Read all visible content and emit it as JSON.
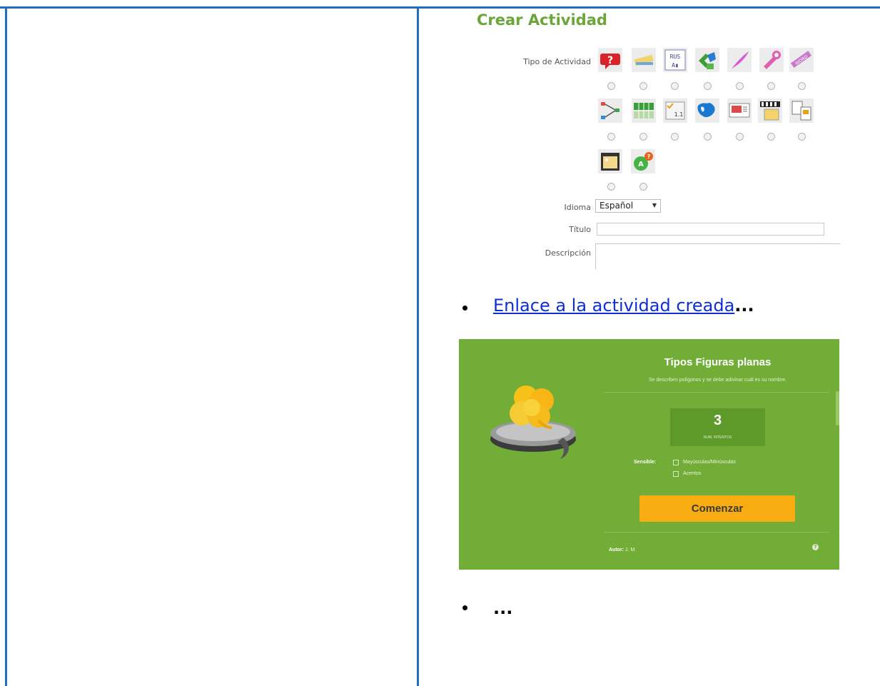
{
  "form": {
    "heading": "Crear Actividad",
    "tipo_label": "Tipo de Actividad",
    "idioma_label": "Idioma",
    "idioma_value": "Español",
    "titulo_label": "Título",
    "descripcion_label": "Descripción",
    "activity_icons": [
      "question-bubble-icon",
      "pencil-ruler-icon",
      "letter-grid-icon",
      "puzzle-icon",
      "feather-pen-icon",
      "wrench-icon",
      "crossword-icon",
      "concept-map-icon",
      "green-grid-icon",
      "numbered-list-icon",
      "world-map-icon",
      "slideshow-icon",
      "film-strip-icon",
      "card-pairs-icon",
      "photo-frame-icon",
      "green-question-icon"
    ]
  },
  "bullets": {
    "link_text": "Enlace a la actividad creada",
    "link_suffix": "...",
    "second_bullet": "..."
  },
  "preview": {
    "title": "Tipos Figuras planas",
    "subtitle": "Se describen polígonos y se debe adivinar cuál es su nombre.",
    "attempts_number": "3",
    "attempts_label": "NUM. INTENTOS",
    "sensible_label": "Sensible:",
    "option_case": "Mayúsculas/Minúsculas",
    "option_accents": "Acentos",
    "start_button": "Comenzar",
    "author_label": "Autor:",
    "author_name": "J. M."
  },
  "colors": {
    "frame_blue": "#1f6fc0",
    "heading_green": "#6aa63a",
    "panel_green": "#72ad37",
    "button_orange": "#f7ad12",
    "link_blue": "#0d2fd8"
  }
}
